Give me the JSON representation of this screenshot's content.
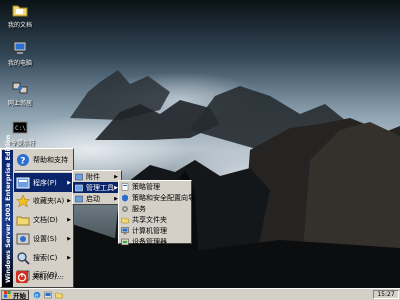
{
  "desktop": {
    "icons": [
      {
        "label": "我的文档",
        "icon": "folder-documents-icon"
      },
      {
        "label": "我的电脑",
        "icon": "my-computer-icon"
      },
      {
        "label": "网上邻居",
        "icon": "network-icon"
      },
      {
        "label": "命令提示符",
        "icon": "command-prompt-icon"
      }
    ]
  },
  "start_menu": {
    "banner": "Windows Server 2003  Enterprise Edition",
    "items": [
      {
        "label": "帮助和支持",
        "icon": "help-icon",
        "submenu": false
      },
      {
        "label": "程序(P)",
        "icon": "programs-icon",
        "submenu": true
      },
      {
        "label": "收藏夹(A)",
        "icon": "favorites-star-icon",
        "submenu": true
      },
      {
        "label": "文档(D)",
        "icon": "documents-icon",
        "submenu": true
      },
      {
        "label": "设置(S)",
        "icon": "settings-icon",
        "submenu": true
      },
      {
        "label": "搜索(C)",
        "icon": "search-icon",
        "submenu": true
      },
      {
        "label": "运行(R)...",
        "icon": "run-icon",
        "submenu": false
      },
      {
        "label": "关机(U)...",
        "icon": "shutdown-icon",
        "submenu": false
      }
    ]
  },
  "programs_menu": [
    {
      "label": "附件",
      "submenu": true
    },
    {
      "label": "管理工具",
      "submenu": true
    },
    {
      "label": "启动",
      "submenu": true
    }
  ],
  "admin_tools_menu": [
    "策略管理",
    "策略和安全配置向导",
    "服务",
    "共享文件夹",
    "计算机管理",
    "设备管理器"
  ],
  "taskbar": {
    "start_label": "开始",
    "clock": "15:27"
  },
  "colors": {
    "menu_bg": "#d4d0c8",
    "highlight": "#0a246a"
  }
}
